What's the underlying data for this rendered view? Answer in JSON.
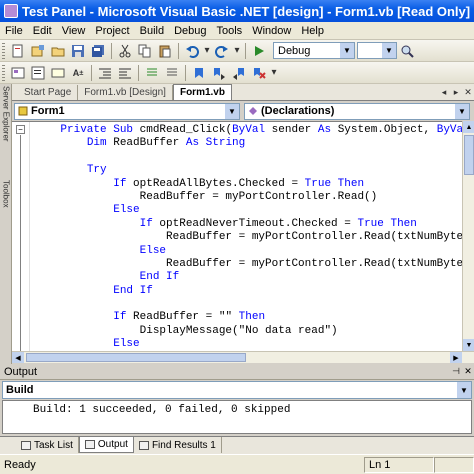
{
  "window": {
    "title": "Test Panel - Microsoft Visual Basic .NET [design] - Form1.vb [Read Only]"
  },
  "menu": [
    {
      "label": "File",
      "name": "menu-file"
    },
    {
      "label": "Edit",
      "name": "menu-edit"
    },
    {
      "label": "View",
      "name": "menu-view"
    },
    {
      "label": "Project",
      "name": "menu-project"
    },
    {
      "label": "Build",
      "name": "menu-build"
    },
    {
      "label": "Debug",
      "name": "menu-debug"
    },
    {
      "label": "Tools",
      "name": "menu-tools"
    },
    {
      "label": "Window",
      "name": "menu-window"
    },
    {
      "label": "Help",
      "name": "menu-help"
    }
  ],
  "toolbar": {
    "config_value": "Debug"
  },
  "side_tabs": {
    "server_explorer": "Server Explorer",
    "toolbox": "Toolbox"
  },
  "doc_tabs": [
    {
      "label": "Start Page",
      "active": false
    },
    {
      "label": "Form1.vb [Design]",
      "active": false
    },
    {
      "label": "Form1.vb",
      "active": true
    }
  ],
  "code_nav": {
    "class_value": "Form1",
    "method_value": "(Declarations)"
  },
  "code_lines": [
    [
      {
        "t": "    "
      },
      {
        "t": "Private Sub",
        "k": 1
      },
      {
        "t": " cmdRead_Click("
      },
      {
        "t": "ByVal",
        "k": 1
      },
      {
        "t": " sender "
      },
      {
        "t": "As",
        "k": 1
      },
      {
        "t": " System.Object, "
      },
      {
        "t": "ByVa",
        "k": 1
      }
    ],
    [
      {
        "t": "        "
      },
      {
        "t": "Dim",
        "k": 1
      },
      {
        "t": " ReadBuffer "
      },
      {
        "t": "As String",
        "k": 1
      }
    ],
    [
      {
        "t": ""
      }
    ],
    [
      {
        "t": "        "
      },
      {
        "t": "Try",
        "k": 1
      }
    ],
    [
      {
        "t": "            "
      },
      {
        "t": "If",
        "k": 1
      },
      {
        "t": " optReadAllBytes.Checked = "
      },
      {
        "t": "True Then",
        "k": 1
      }
    ],
    [
      {
        "t": "                ReadBuffer = myPortController.Read()"
      }
    ],
    [
      {
        "t": "            "
      },
      {
        "t": "Else",
        "k": 1
      }
    ],
    [
      {
        "t": "                "
      },
      {
        "t": "If",
        "k": 1
      },
      {
        "t": " optReadNeverTimeout.Checked = "
      },
      {
        "t": "True Then",
        "k": 1
      }
    ],
    [
      {
        "t": "                    ReadBuffer = myPortController.Read(txtNumByte"
      }
    ],
    [
      {
        "t": "                "
      },
      {
        "t": "Else",
        "k": 1
      }
    ],
    [
      {
        "t": "                    ReadBuffer = myPortController.Read(txtNumByte"
      }
    ],
    [
      {
        "t": "                "
      },
      {
        "t": "End If",
        "k": 1
      }
    ],
    [
      {
        "t": "            "
      },
      {
        "t": "End If",
        "k": 1
      }
    ],
    [
      {
        "t": ""
      }
    ],
    [
      {
        "t": "            "
      },
      {
        "t": "If",
        "k": 1
      },
      {
        "t": " ReadBuffer = \"\" "
      },
      {
        "t": "Then",
        "k": 1
      }
    ],
    [
      {
        "t": "                DisplayMessage(\"No data read\")"
      }
    ],
    [
      {
        "t": "            "
      },
      {
        "t": "Else",
        "k": 1
      }
    ]
  ],
  "output": {
    "title": "Output",
    "pane_value": "Build",
    "text": "Build: 1 succeeded, 0 failed, 0 skipped"
  },
  "bottom_tabs": [
    {
      "label": "Task List",
      "active": false
    },
    {
      "label": "Output",
      "active": true
    },
    {
      "label": "Find Results 1",
      "active": false
    }
  ],
  "status": {
    "ready": "Ready",
    "line": "Ln 1"
  },
  "colors": {
    "keyword": "#0000ff",
    "titlebar": "#0550dc"
  }
}
